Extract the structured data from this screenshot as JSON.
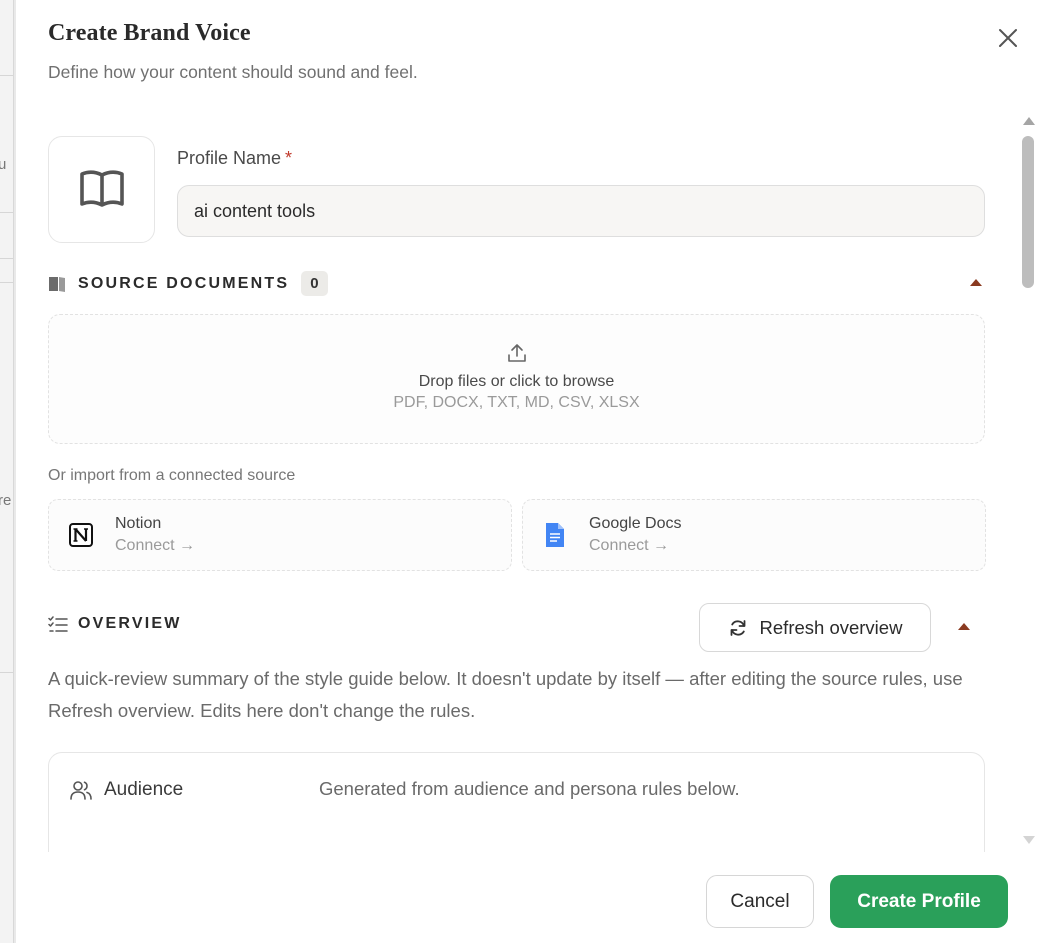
{
  "background": {
    "fragment_1": "u",
    "fragment_2": "re"
  },
  "modal": {
    "title": "Create Brand Voice",
    "subtitle": "Define how your content should sound and feel."
  },
  "profile": {
    "label": "Profile Name",
    "required_mark": "*",
    "value": "ai content tools",
    "icon": "book-icon"
  },
  "source_documents": {
    "title": "SOURCE DOCUMENTS",
    "count": "0",
    "dropzone_main": "Drop files or click to browse",
    "dropzone_formats": "PDF, DOCX, TXT, MD, CSV, XLSX",
    "import_label": "Or import from a connected source",
    "sources": [
      {
        "name": "Notion",
        "action": "Connect →",
        "icon": "notion-icon"
      },
      {
        "name": "Google Docs",
        "action": "Connect →",
        "icon": "google-docs-icon"
      }
    ]
  },
  "overview": {
    "title": "OVERVIEW",
    "refresh_label": "Refresh overview",
    "description": "A quick-review summary of the style guide below. It doesn't update by itself — after editing the source rules, use Refresh overview. Edits here don't change the rules.",
    "items": [
      {
        "label": "Audience",
        "text": "Generated from audience and persona rules below.",
        "icon": "users-icon"
      }
    ]
  },
  "footer": {
    "cancel_label": "Cancel",
    "create_label": "Create Profile"
  },
  "colors": {
    "primary": "#2aa05a",
    "accent": "#8a3a20",
    "required": "#c0392b",
    "google_docs": "#4285f4"
  }
}
